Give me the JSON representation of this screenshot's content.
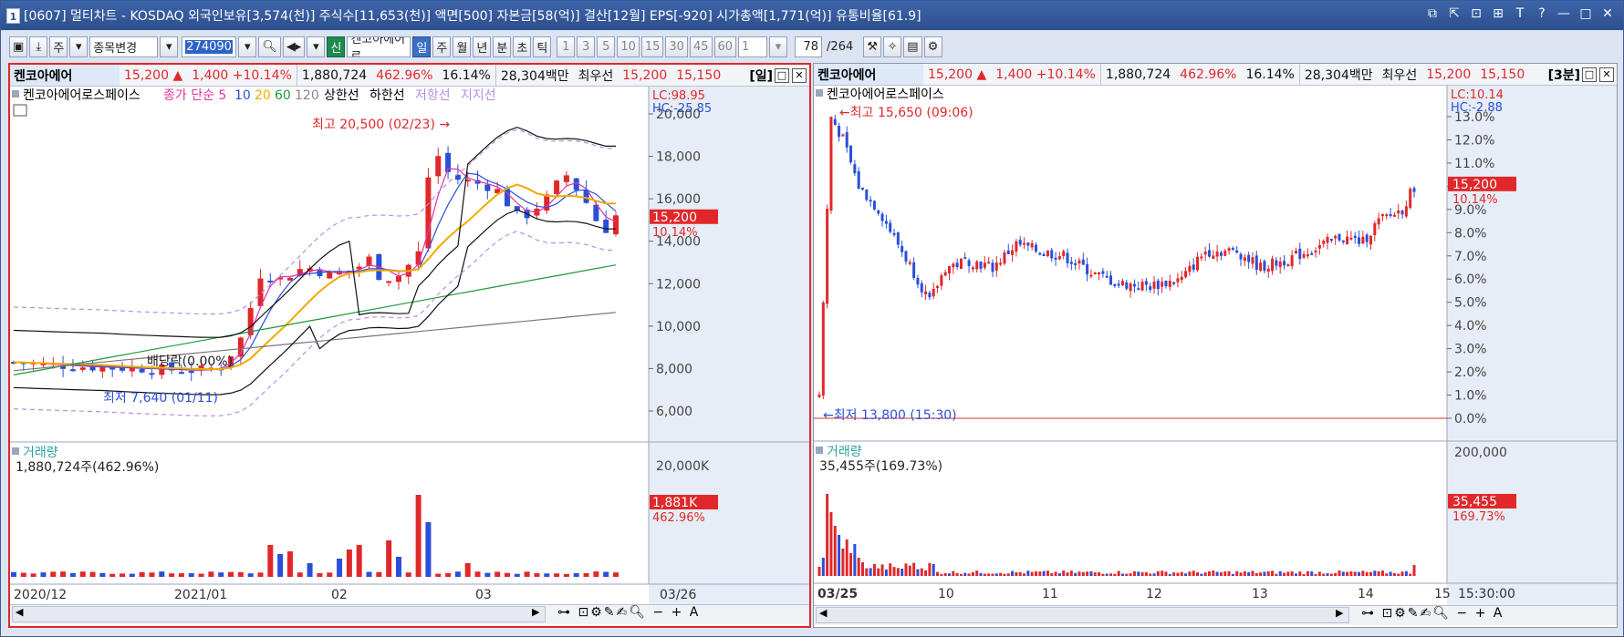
{
  "window": {
    "icon_label": "1",
    "title": "[0607] 멀티차트 - KOSDAQ 외국인보유[3,574(천)] 주식수[11,653(천)] 액면[500] 자본금[58(억)] 결산[12월] EPS[-920] 시가총액[1,771(억)] 유통비율[61.9]",
    "buttons": [
      "⧉",
      "⇱",
      "⊡",
      "⊞",
      "T",
      "?",
      "—",
      "□",
      "✕"
    ]
  },
  "toolbar": {
    "stock_type": "주",
    "stock_change": "종목변경",
    "code": "274090",
    "new_label": "신",
    "stock_name": "켄코아에어로",
    "periods": [
      "일",
      "주",
      "월",
      "년",
      "분",
      "초",
      "틱"
    ],
    "selected_period": "일",
    "intervals": [
      "1",
      "3",
      "5",
      "10",
      "15",
      "30",
      "45",
      "60"
    ],
    "count": "1",
    "page": "78",
    "page_total": "/264"
  },
  "left_chart": {
    "header": {
      "name": "켄코아에어",
      "price": "15,200",
      "arrow": "▲",
      "change": "1,400",
      "change_pct": "+10.14%",
      "volume": "1,880,724",
      "vol_ratio": "462.96%",
      "turnover": "16.14%",
      "amount": "28,304백만",
      "priority": "최우선",
      "ask": "15,200",
      "bid": "15,150",
      "period": "[일]"
    },
    "legend": {
      "stock": "켄코아에어로스페이스",
      "ma_prefix": "종가 단순",
      "ma": [
        "5",
        "10",
        "20",
        "60",
        "120"
      ],
      "upper": "상한선",
      "lower": "하한선",
      "resist": "저항선",
      "support": "지지선"
    },
    "lc": "LC:98.95",
    "hc": "HC:-25.85",
    "max_note": "최고 20,500 (02/23) →",
    "min_note": "최저 7,640 (01/11)",
    "dividend_note": "배당락(0.00%)",
    "price_ticks": [
      "20,000",
      "18,000",
      "16,000",
      "14,000",
      "12,000",
      "10,000",
      "8,000",
      "6,000"
    ],
    "current_price": "15,200",
    "current_pct": "10.14%",
    "volume_title": "거래량",
    "volume_value": "1,880,724주(462.96%)",
    "volume_tick": "20,000K",
    "volume_current": "1,881K",
    "volume_pct": "462.96%",
    "dates": [
      "2020/12",
      "2021/01",
      "02",
      "03",
      "03/26"
    ]
  },
  "right_chart": {
    "header": {
      "name": "켄코아에어",
      "price": "15,200",
      "arrow": "▲",
      "change": "1,400",
      "change_pct": "+10.14%",
      "volume": "1,880,724",
      "vol_ratio": "462.96%",
      "turnover": "16.14%",
      "amount": "28,304백만",
      "priority": "최우선",
      "ask": "15,200",
      "bid": "15,150",
      "period": "[3분]"
    },
    "legend": {
      "stock": "켄코아에어로스페이스"
    },
    "lc": "LC:10.14",
    "hc": "HC:-2.88",
    "max_note": "최고 15,650 (09:06)",
    "min_note": "최저 13,800 (15:30)",
    "pct_ticks": [
      "13.0%",
      "12.0%",
      "11.0%",
      "10.0%",
      "9.0%",
      "8.0%",
      "7.0%",
      "6.0%",
      "5.0%",
      "4.0%",
      "3.0%",
      "2.0%",
      "1.0%",
      "0.0%"
    ],
    "current_price": "15,200",
    "current_pct": "10.14%",
    "volume_title": "거래량",
    "volume_value": "35,455주(169.73%)",
    "volume_tick": "200,000",
    "volume_current": "35,455",
    "volume_pct": "169.73%",
    "dates": [
      "03/25",
      "10",
      "11",
      "12",
      "13",
      "14",
      "15",
      "15:30:00"
    ]
  },
  "colors": {
    "up": "#e0282a",
    "down": "#2a4fd8",
    "ma5": "#e033a6",
    "ma10": "#2a4fd8",
    "ma20": "#f2a900",
    "ma60": "#1f9a3a",
    "ma120": "#777777"
  }
}
